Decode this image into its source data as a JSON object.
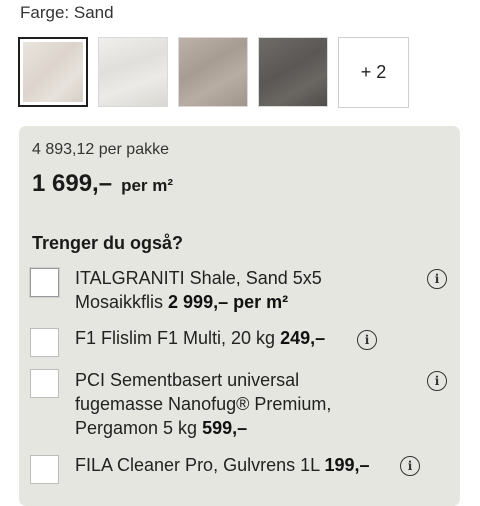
{
  "color_label": "Farge: Sand",
  "swatches": [
    {
      "name": "sand",
      "selected": true
    },
    {
      "name": "light-grey",
      "selected": false
    },
    {
      "name": "taupe",
      "selected": false
    },
    {
      "name": "dark-grey",
      "selected": false
    }
  ],
  "more_label": "+ 2",
  "per_pack_price": "4 893,12 per pakke",
  "price": "1 699,–",
  "price_unit": "per m²",
  "also_title": "Trenger du også?",
  "items": [
    {
      "line1": "ITALGRANITI Shale, Sand 5x5",
      "line2": "Mosaikkflis",
      "price": "2 999,– per m²"
    },
    {
      "line1": "F1 Flislim F1 Multi, 20 kg",
      "price": "249,–"
    },
    {
      "line1": "PCI Sementbasert universal",
      "line2": "fugemasse Nanofug® Premium,",
      "line3": "Pergamon 5 kg",
      "price": "599,–"
    },
    {
      "line1": "FILA Cleaner Pro, Gulvrens 1L",
      "price": "199,–"
    }
  ],
  "info_glyph": "i"
}
